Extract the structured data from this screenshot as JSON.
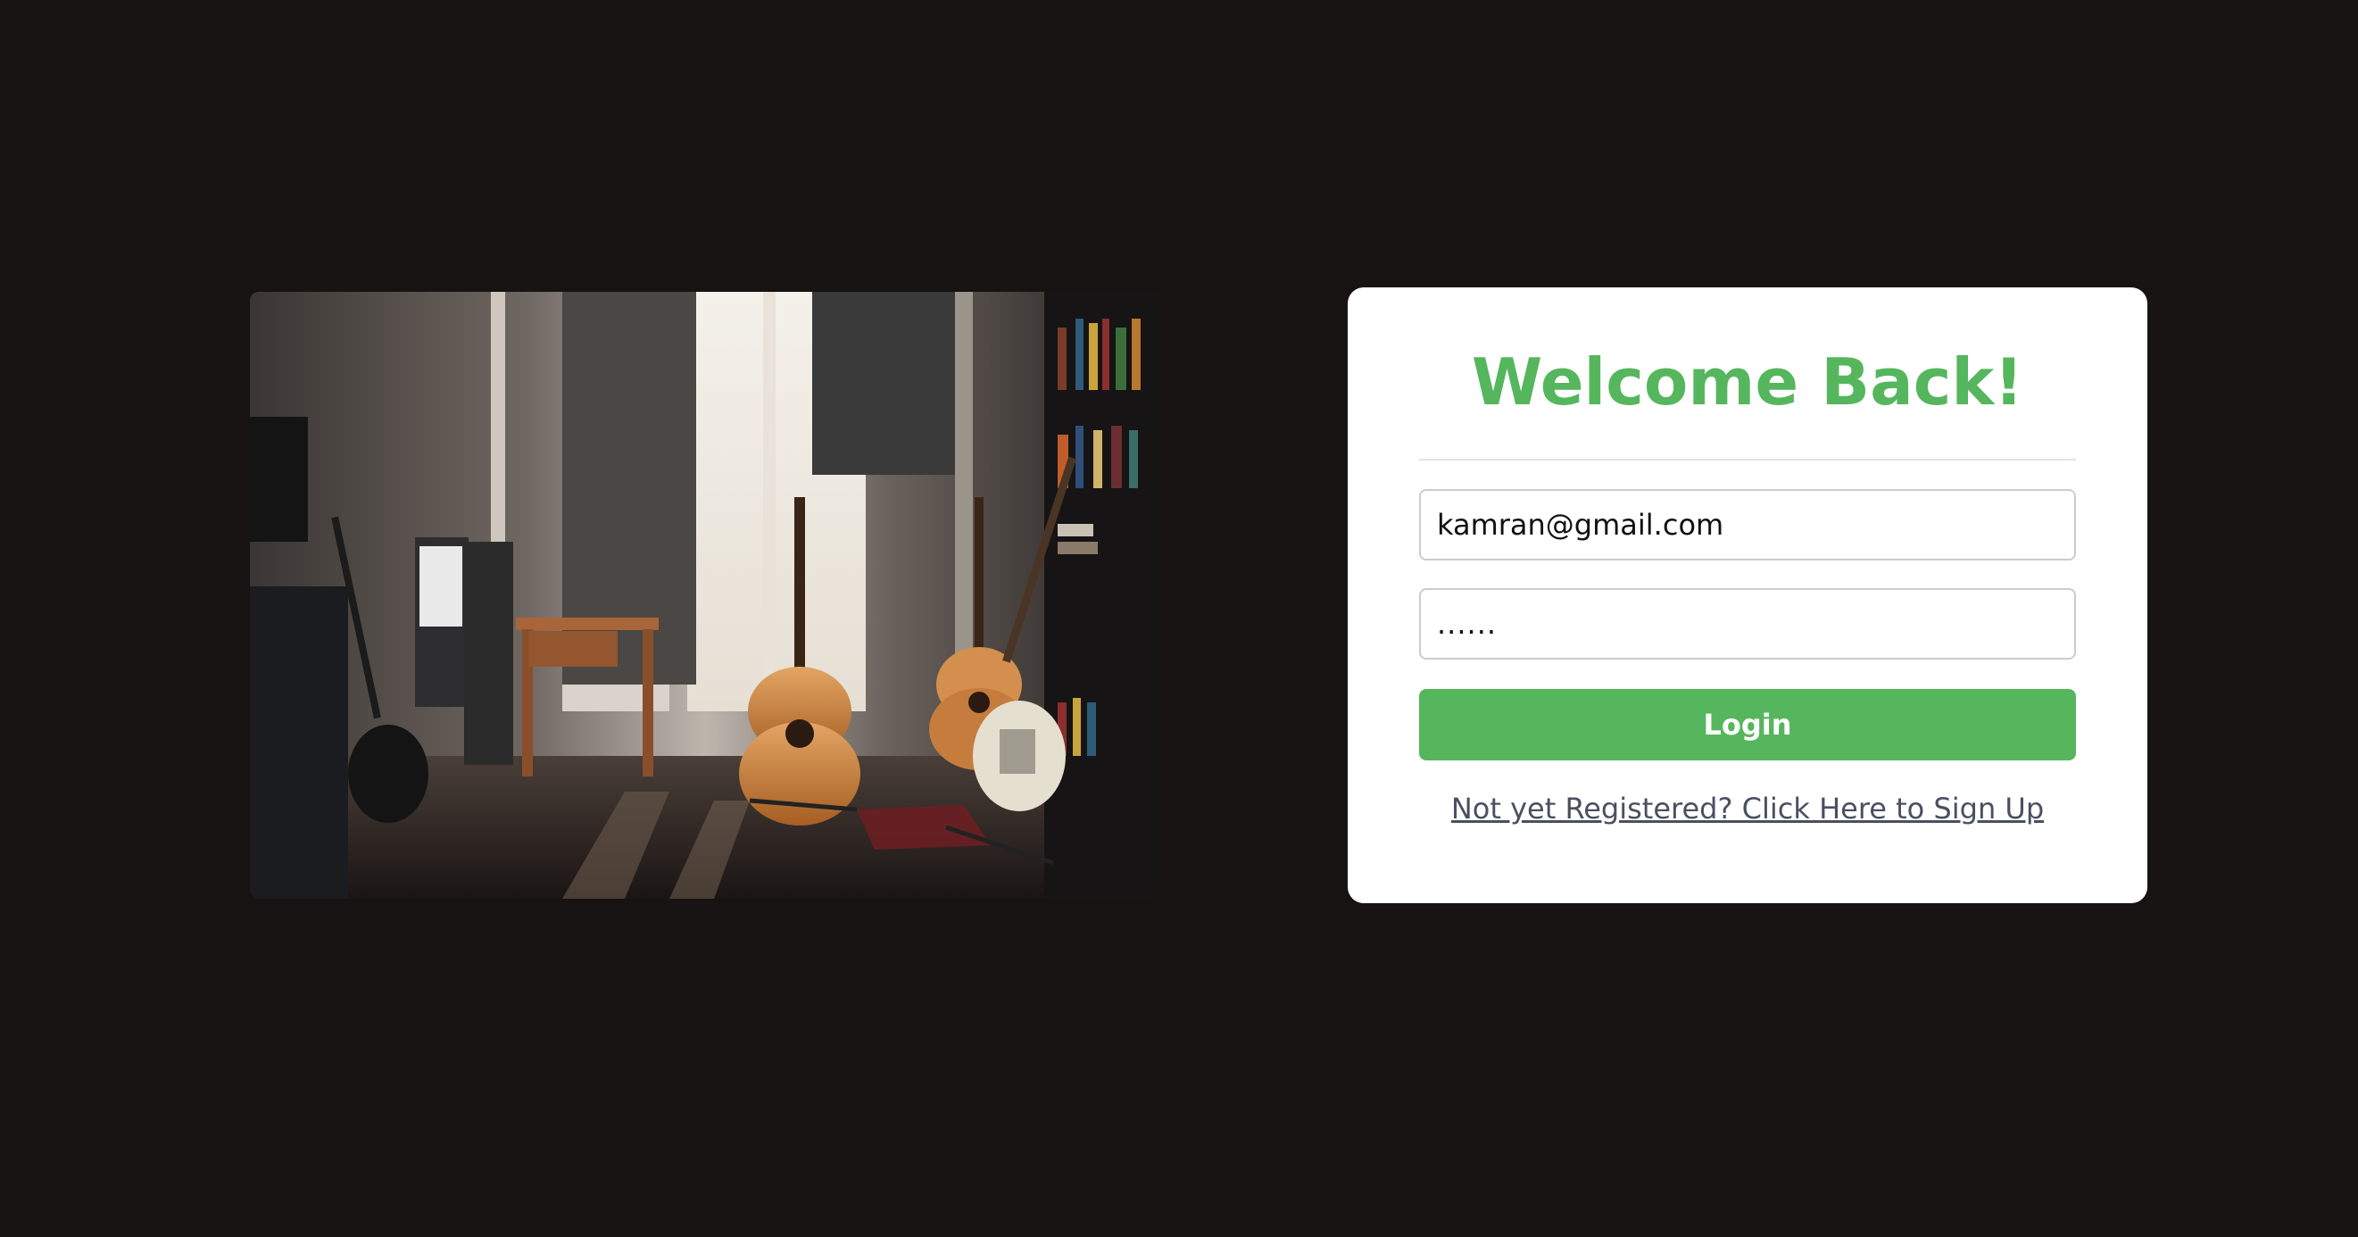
{
  "photo": {
    "alt_subject": "music-room-guitars"
  },
  "login": {
    "title": "Welcome Back!",
    "email_value": "kamran@gmail.com",
    "password_value": "......",
    "login_label": "Login",
    "signup_link": "Not yet Registered? Click Here to Sign Up"
  },
  "colors": {
    "background": "#161312",
    "card": "#ffffff",
    "accent_green": "#56b65d",
    "link": "#4a5060",
    "input_border": "#c9ccd1"
  }
}
